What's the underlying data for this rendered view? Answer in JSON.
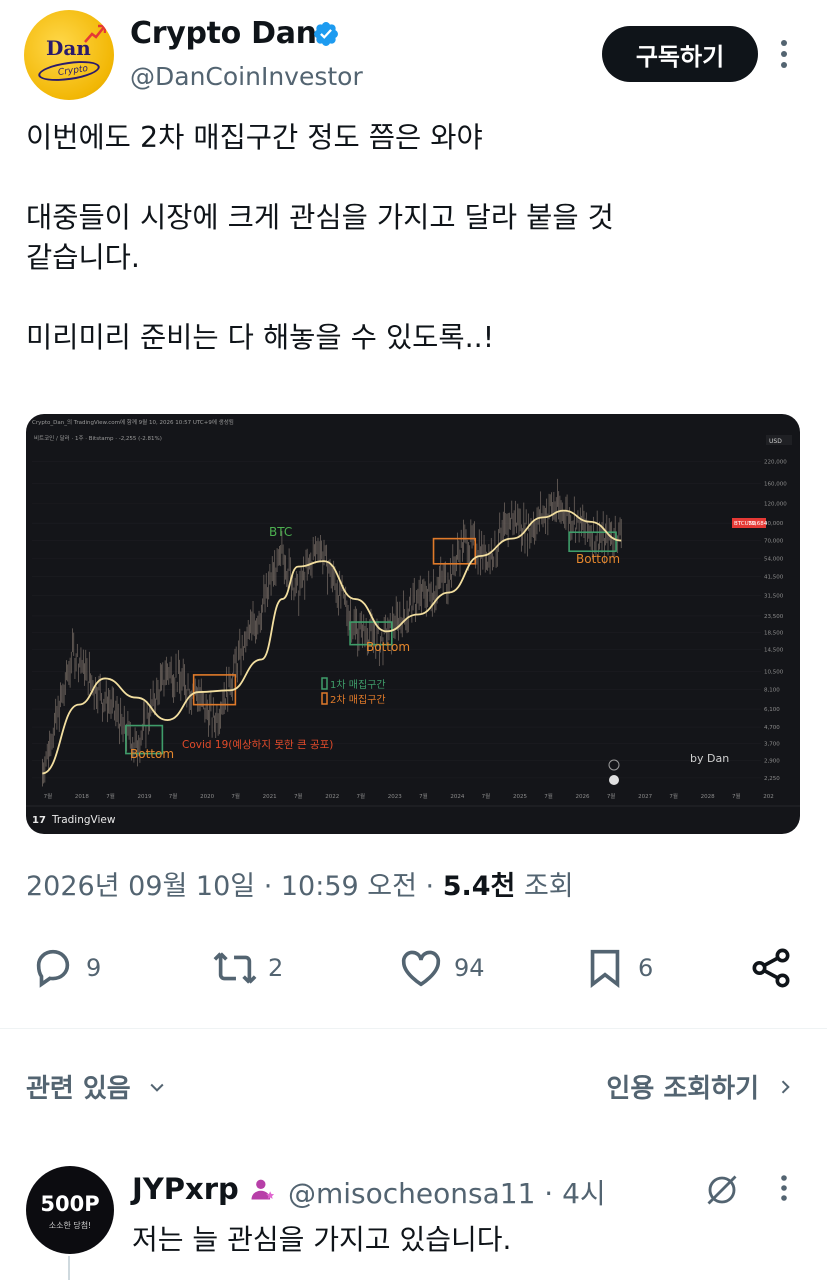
{
  "author": {
    "display_name": "Crypto Dan",
    "handle": "@DanCoinInvestor",
    "avatar_text": "Dan",
    "avatar_subtext": "Crypto"
  },
  "header": {
    "subscribe_label": "구독하기"
  },
  "tweet": {
    "text": "이번에도 2차 매집구간 정도 쯤은 와야\n\n대중들이 시장에 크게 관심을 가지고 달라 붙을 것\n같습니다.\n\n미리미리 준비는 다 해놓을 수 있도록..!"
  },
  "meta": {
    "date": "2026년 09월 10일",
    "sep1": " · ",
    "time": "10:59 오전",
    "sep2": " · ",
    "views_count": "5.4천",
    "views_label": " 조회"
  },
  "actions": {
    "replies": "9",
    "reposts": "2",
    "likes": "94",
    "bookmarks": "6"
  },
  "related": {
    "label": "관련 있음",
    "quotes_label": "인용 조회하기"
  },
  "reply": {
    "display_name": "JYPxrp",
    "handle": "@misocheonsa11 · 4시",
    "text": "저는 늘 관심을 가지고 있습니다.",
    "avatar_text": "500P",
    "avatar_subtext": "소소한 당첨!"
  },
  "chart": {
    "header_line": "Crypto_Dan_의 TradingView.com에 함께 9월 10, 2026 10:57 UTC+9에 생성됨",
    "symbol_line": "비트코인 / 달러 · 1주 · Bitstamp · -2,255 (-2.81%)",
    "currency": "USD",
    "price_tag": "BTCUSD",
    "price_value": "79,684",
    "btc_label": "BTC",
    "bottom_label": "Bottom",
    "legend_1": "1차 매집구간",
    "legend_2": "2차 매집구간",
    "covid_label": "Covid 19(예상하지 못한 큰 공포)",
    "by_label": "by Dan",
    "brand": "TradingView",
    "colors": {
      "bg": "#141519",
      "candle": "#8a7d74",
      "ma_line": "#f3dfa0",
      "zone1": "#3f9d6a",
      "zone2": "#e07a2a",
      "label_bottom": "#e5872d",
      "label_btc": "#4caf50",
      "covid": "#e04a2a"
    }
  },
  "chart_data": {
    "type": "line",
    "title": "",
    "xlabel": "",
    "ylabel": "",
    "x_ticks": [
      "7월",
      "2018",
      "7월",
      "2019",
      "7월",
      "2020",
      "7월",
      "2021",
      "7월",
      "2022",
      "7월",
      "2023",
      "7월",
      "2024",
      "7월",
      "2025",
      "7월",
      "2026",
      "7월",
      "2027",
      "7월",
      "2028",
      "7월",
      "202"
    ],
    "y_ticks": [
      "220,000",
      "160,000",
      "120,000",
      "90,000",
      "70,000",
      "54,000",
      "41,500",
      "31,500",
      "23,500",
      "18,500",
      "14,500",
      "10,500",
      "8,100",
      "6,100",
      "4,700",
      "3,700",
      "2,900",
      "2,250"
    ],
    "log_scale": true,
    "series": [
      {
        "values_x": [
          "2017-06",
          "2017-12",
          "2018-06",
          "2018-12",
          "2019-06",
          "2019-12",
          "2020-03",
          "2020-06",
          "2020-12",
          "2021-04",
          "2021-07",
          "2021-11",
          "2022-06",
          "2022-11",
          "2023-06",
          "2023-12",
          "2024-03",
          "2024-08",
          "2024-12",
          "2025-03",
          "2025-08",
          "2025-12",
          "2026-06",
          "2026-09"
        ],
        "values_y": [
          2500,
          14000,
          7000,
          3600,
          11000,
          7500,
          5000,
          9500,
          27000,
          58000,
          34000,
          66000,
          20000,
          16500,
          30000,
          42000,
          70000,
          57000,
          100000,
          82000,
          118000,
          95000,
          70000,
          79684
        ]
      },
      {
        "values_x": [
          "2017-06",
          "2018-01",
          "2018-06",
          "2018-12",
          "2019-06",
          "2019-12",
          "2020-06",
          "2020-12",
          "2021-04",
          "2021-07",
          "2021-12",
          "2022-06",
          "2022-12",
          "2023-06",
          "2023-12",
          "2024-06",
          "2024-12",
          "2025-06",
          "2025-10",
          "2026-03",
          "2026-09"
        ],
        "values_y": [
          2400,
          6500,
          9500,
          7200,
          5200,
          7800,
          8000,
          12500,
          30000,
          48000,
          52000,
          30000,
          18800,
          24000,
          33000,
          56000,
          72000,
          98000,
          108000,
          92000,
          70000
        ]
      }
    ]
  }
}
